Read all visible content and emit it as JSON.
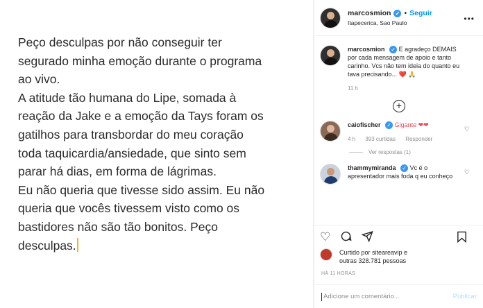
{
  "post": {
    "lines": [
      "Peço desculpas por não conseguir ter",
      "segurado minha emoção durante o programa",
      "ao vivo.",
      "A atitude tão humana do Lipe, somada à",
      "reação da Jake e a emoção da Tays foram os",
      "gatilhos para transbordar do meu coração",
      "toda taquicardia/ansiedade, que sinto sem",
      "parar há dias, em forma de lágrimas.",
      "Eu não queria que tivesse sido assim. Eu não",
      "queria que vocês tivessem visto como os",
      "bastidores não são tão bonitos. Peço",
      "desculpas."
    ]
  },
  "header": {
    "username": "marcosmion",
    "follow_label": "Seguir",
    "location": "Itapecerica, Sao Paulo"
  },
  "caption": {
    "username": "marcosmion",
    "text": "E agradeço DEMAIS por cada mensagem de apoio e tanto carinho. Vcs não tem ideia do quanto eu tava precisando... ❤️ 🙏",
    "time": "11 h"
  },
  "comments": [
    {
      "username": "caiofischer",
      "text": "Gigante ❤❤",
      "time": "4 h",
      "likes": "393 curtidas",
      "reply_label": "Responder",
      "view_replies": "Ver respostas (1)"
    },
    {
      "username": "thammymiranda",
      "text": "Vc é o apresentador mais foda q eu conheço"
    }
  ],
  "likes": {
    "line1": "Curtido por siteareavip e",
    "line2": "outras 328.781 pessoas"
  },
  "timeago": "HÁ 11 HORAS",
  "add_comment": {
    "placeholder": "Adicione um comentário...",
    "publish_label": "Publicar"
  }
}
